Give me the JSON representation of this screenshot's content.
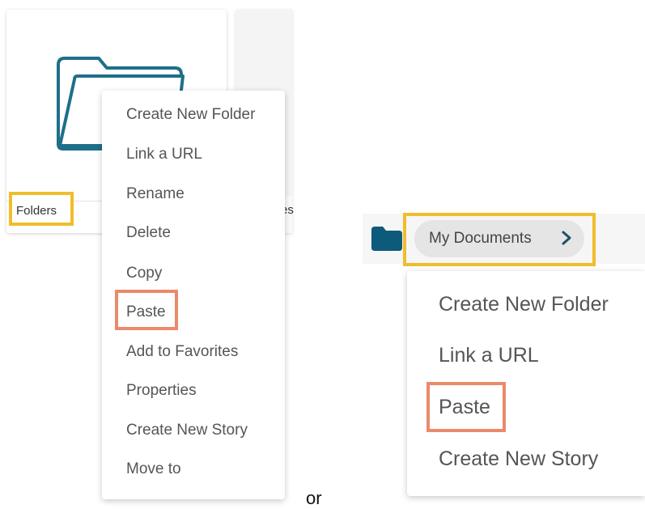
{
  "colors": {
    "folder_teal": "#1e6f8a",
    "highlight_yellow": "#f0bd2b",
    "highlight_orange": "#ea8a6a",
    "folder_dark": "#0d5a7a"
  },
  "left": {
    "card": {
      "icon": "folder-outline-icon",
      "label": "Folders",
      "second_card_label_fragment": "es"
    },
    "context_menu": {
      "items": [
        "Create New Folder",
        "Link a URL",
        "Rename",
        "Delete",
        "Copy",
        "Paste",
        "Add to Favorites",
        "Properties",
        "Create New Story",
        "Move to"
      ]
    }
  },
  "separator_text": "or",
  "right": {
    "breadcrumb": {
      "icon": "folder-filled-icon",
      "label": "My Documents",
      "chevron": "chevron-right-icon"
    },
    "context_menu": {
      "items": [
        "Create New Folder",
        "Link a URL",
        "Paste",
        "Create New Story"
      ]
    }
  }
}
